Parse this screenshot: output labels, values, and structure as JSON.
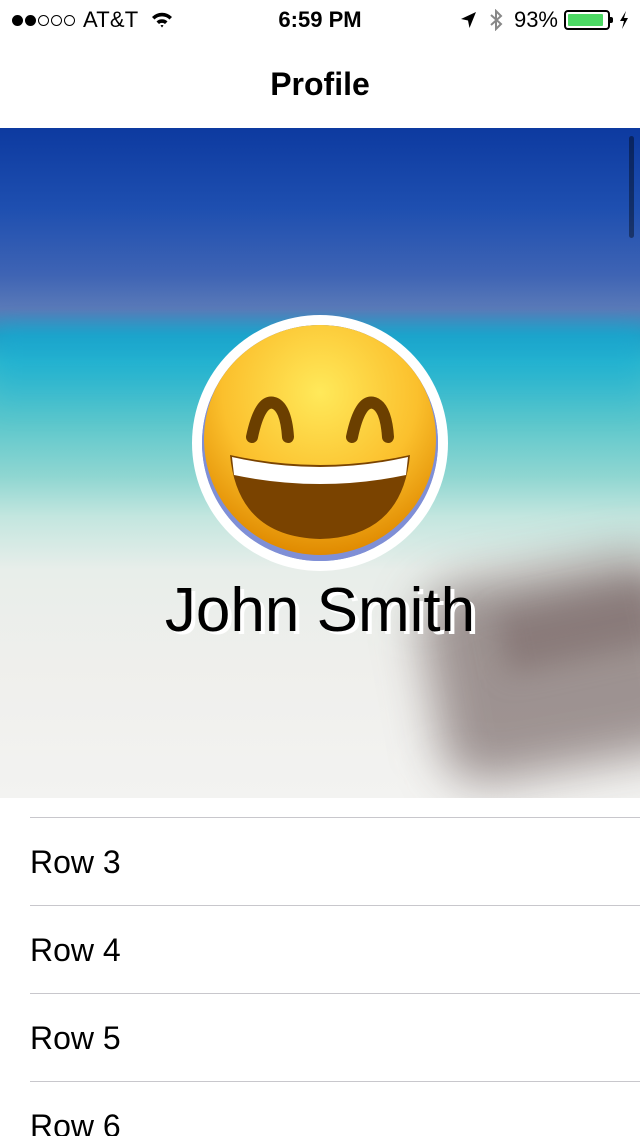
{
  "status_bar": {
    "carrier": "AT&T",
    "signal_bars_filled": 2,
    "signal_bars_total": 5,
    "time": "6:59 PM",
    "battery_percent_text": "93%",
    "battery_level": 0.93,
    "battery_color": "#4cd964",
    "icons": [
      "wifi-icon",
      "location-arrow-icon",
      "bluetooth-icon",
      "battery-icon",
      "charging-bolt-icon"
    ]
  },
  "nav": {
    "title": "Profile"
  },
  "header": {
    "avatar_emoji": "smiling-face-with-open-mouth-and-smiling-eyes",
    "name": "John Smith"
  },
  "list": {
    "items": [
      {
        "label": "Row 3"
      },
      {
        "label": "Row 4"
      },
      {
        "label": "Row 5"
      },
      {
        "label": "Row 6"
      }
    ]
  }
}
